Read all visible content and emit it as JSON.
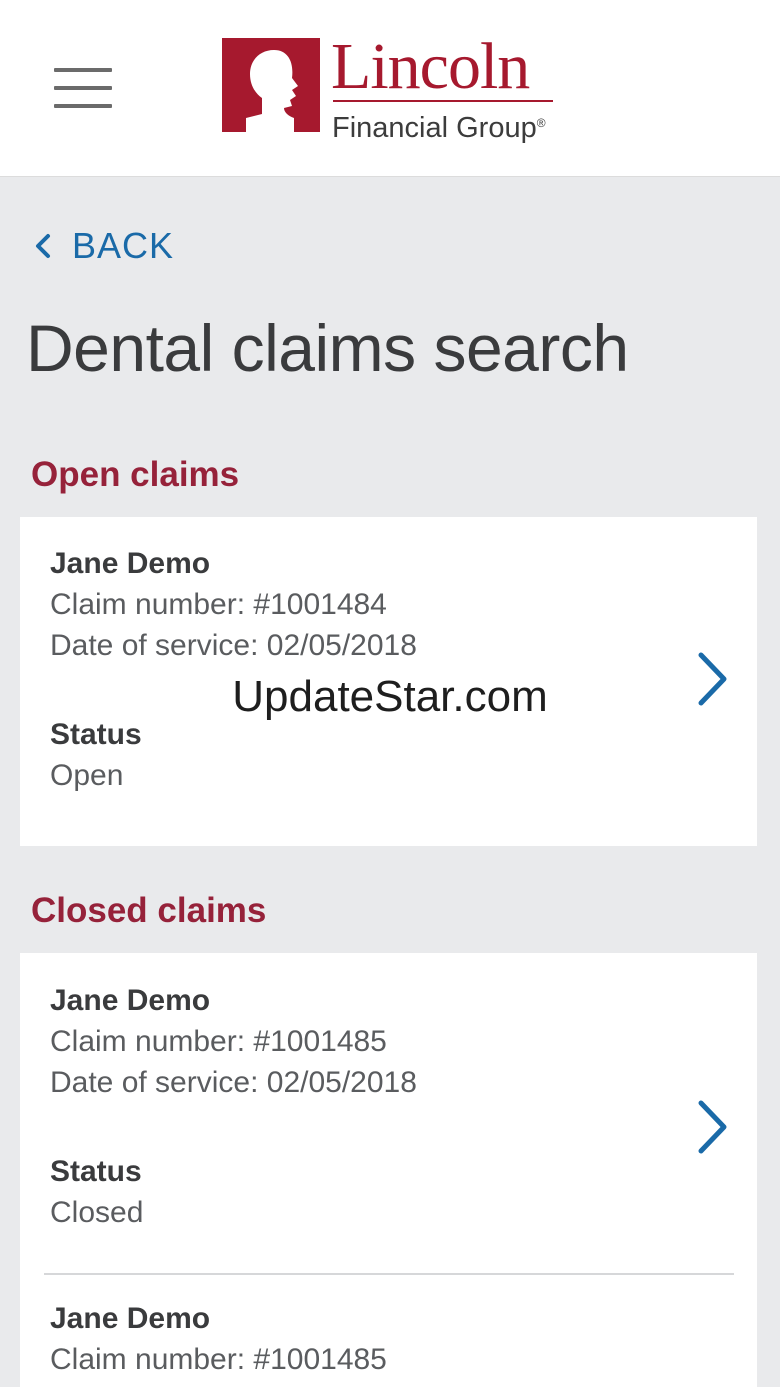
{
  "header": {
    "menu_icon": "hamburger-menu-icon",
    "logo": {
      "name": "Lincoln",
      "sub": "Financial Group",
      "registered": "®",
      "brand_color": "#a6192e"
    }
  },
  "nav": {
    "back_label": "BACK",
    "back_icon": "chevron-left-icon"
  },
  "page": {
    "title": "Dental claims search"
  },
  "open_claims": {
    "title": "Open claims",
    "items": [
      {
        "name": "Jane Demo",
        "claim_number": "Claim number: #1001484",
        "date_of_service": "Date of service: 02/05/2018",
        "status_label": "Status",
        "status": "Open"
      }
    ]
  },
  "closed_claims": {
    "title": "Closed claims",
    "items": [
      {
        "name": "Jane Demo",
        "claim_number": "Claim number: #1001485",
        "date_of_service": "Date of service: 02/05/2018",
        "status_label": "Status",
        "status": "Closed"
      },
      {
        "name": "Jane Demo",
        "claim_number": "Claim number: #1001485"
      }
    ]
  },
  "watermark": "UpdateStar.com",
  "colors": {
    "accent_blue": "#1a6aa8",
    "section_red": "#96223a",
    "background": "#e9eaec"
  }
}
